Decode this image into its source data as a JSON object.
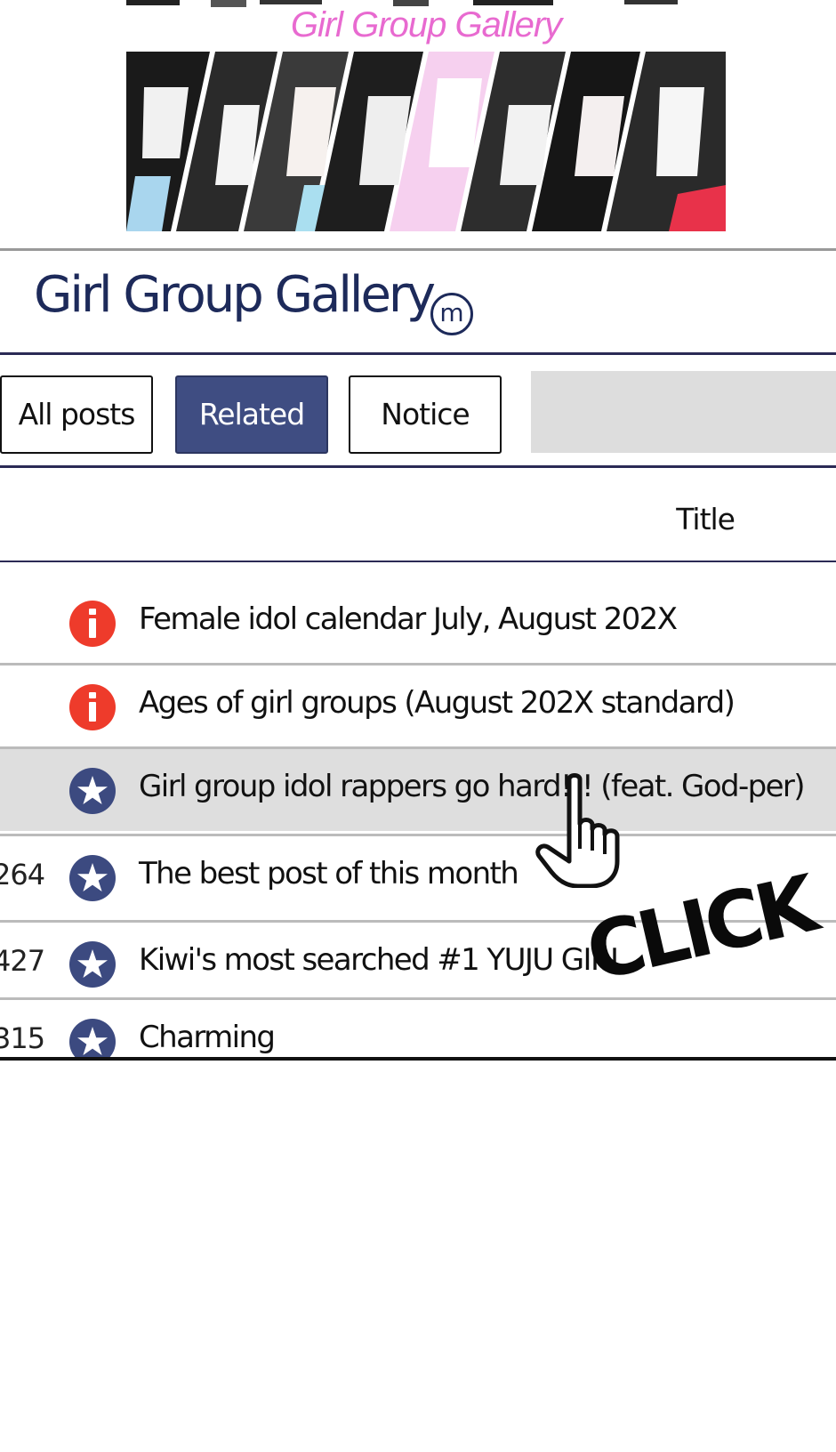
{
  "banner": {
    "title": "Girl Group Gallery"
  },
  "gallery": {
    "title": "Girl Group Gallery",
    "badge": "m"
  },
  "tabs": [
    {
      "label": "All posts",
      "active": false
    },
    {
      "label": "Related",
      "active": true
    },
    {
      "label": "Notice",
      "active": false
    }
  ],
  "table": {
    "column_title": "Title",
    "rows": [
      {
        "number": "",
        "icon": "info-icon",
        "title": "Female idol calendar July, August 202X",
        "hover": false
      },
      {
        "number": "",
        "icon": "info-icon",
        "title": "Ages of girl groups (August 202X standard)",
        "hover": false
      },
      {
        "number": "",
        "icon": "star-icon",
        "title": "Girl group idol rappers go hard!!! (feat. God-per)",
        "hover": true
      },
      {
        "number": "264",
        "icon": "star-icon",
        "title": "The best post of this month",
        "hover": false
      },
      {
        "number": "427",
        "icon": "star-icon",
        "title": "Kiwi's most searched #1 YUJU GIRL",
        "hover": false
      },
      {
        "number": "315",
        "icon": "star-icon",
        "title": "Charming",
        "hover": false
      }
    ]
  },
  "overlay": {
    "click_text": "CLICK",
    "cursor_icon": "hand-pointer-icon"
  },
  "colors": {
    "navy": "#1d2a5a",
    "tab_active": "#3f4d82",
    "info_red": "#ee3b2b",
    "star_navy": "#3c4a80",
    "banner_pink": "#e86ad0",
    "hover_row": "#dedede"
  }
}
